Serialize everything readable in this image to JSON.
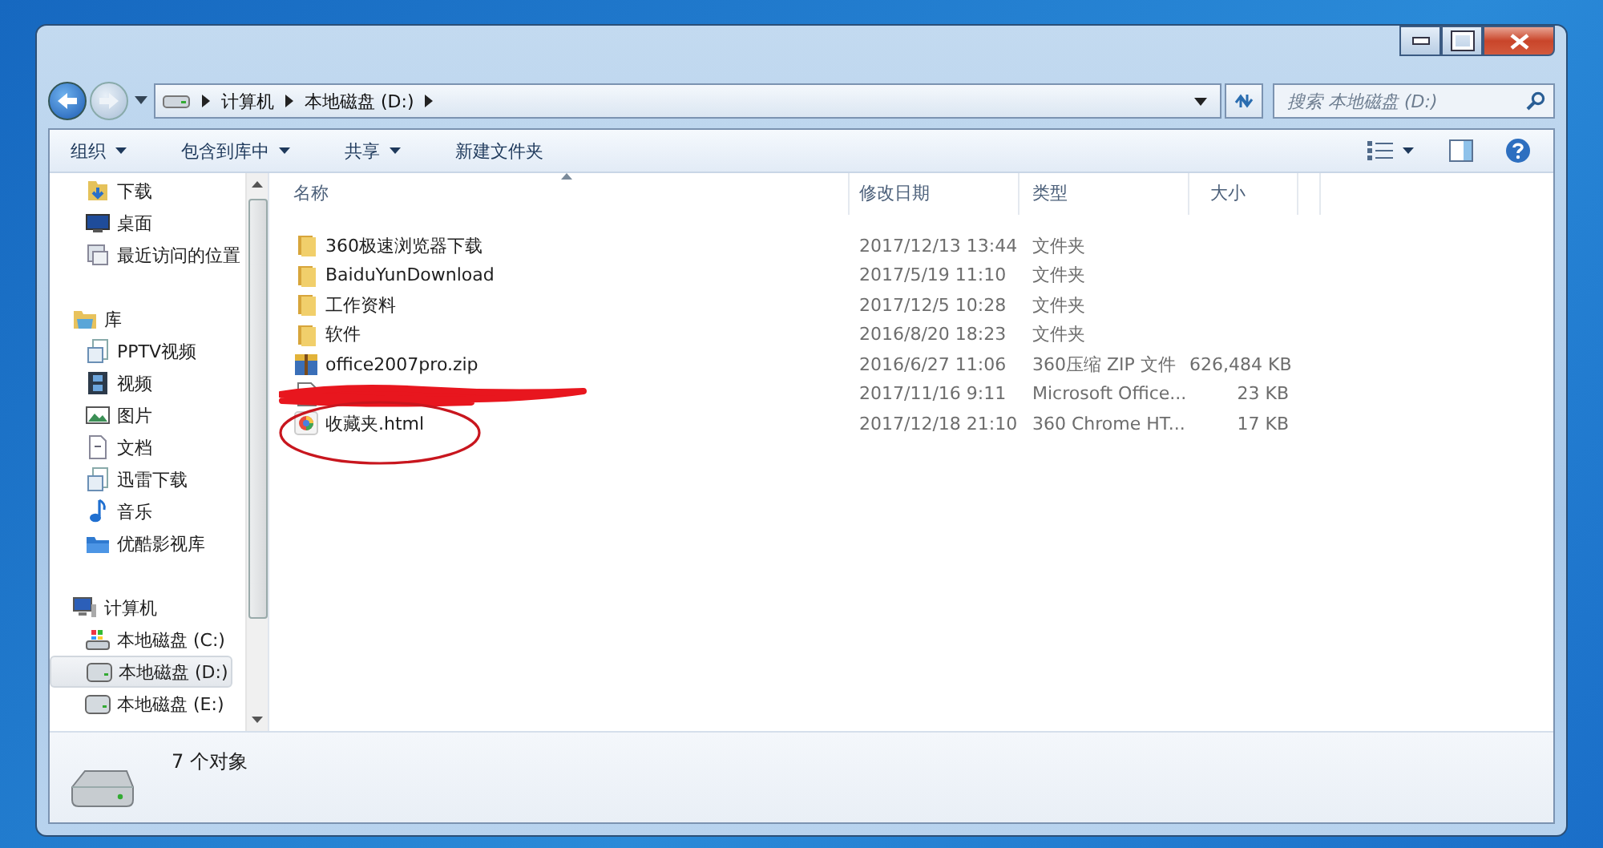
{
  "address": {
    "crumbs": [
      "计算机",
      "本地磁盘 (D:)"
    ]
  },
  "search": {
    "placeholder": "搜索 本地磁盘 (D:)"
  },
  "toolbar": [
    {
      "label": "组织",
      "dropdown": true
    },
    {
      "label": "包含到库中",
      "dropdown": true
    },
    {
      "label": "共享",
      "dropdown": true
    },
    {
      "label": "新建文件夹",
      "dropdown": false
    }
  ],
  "sidebar": {
    "groups": [
      {
        "items": [
          {
            "label": "下载",
            "kind": "download",
            "selected": false
          },
          {
            "label": "桌面",
            "kind": "desktop",
            "selected": false
          },
          {
            "label": "最近访问的位置",
            "kind": "recent",
            "selected": false
          }
        ]
      },
      {
        "header": {
          "label": "库",
          "kind": "library",
          "selected": false
        },
        "items": [
          {
            "label": "PPTV视频",
            "kind": "libitem",
            "selected": false
          },
          {
            "label": "视频",
            "kind": "video",
            "selected": false
          },
          {
            "label": "图片",
            "kind": "picture",
            "selected": false
          },
          {
            "label": "文档",
            "kind": "doc",
            "selected": false
          },
          {
            "label": "迅雷下载",
            "kind": "libitem",
            "selected": false
          },
          {
            "label": "音乐",
            "kind": "music",
            "selected": false
          },
          {
            "label": "优酷影视库",
            "kind": "bluefolder",
            "selected": false
          }
        ]
      },
      {
        "header": {
          "label": "计算机",
          "kind": "computer",
          "selected": false
        },
        "items": [
          {
            "label": "本地磁盘 (C:)",
            "kind": "sysdrive",
            "selected": false
          },
          {
            "label": "本地磁盘 (D:)",
            "kind": "drive",
            "selected": true
          },
          {
            "label": "本地磁盘 (E:)",
            "kind": "drive",
            "selected": false
          }
        ]
      }
    ]
  },
  "file_list": {
    "columns": [
      "名称",
      "修改日期",
      "类型",
      "大小"
    ],
    "rows": [
      {
        "kind": "folder",
        "name": "360极速浏览器下载",
        "date": "2017/12/13 13:44",
        "type": "文件夹",
        "redacted": false,
        "circled": false
      },
      {
        "kind": "folder",
        "name": "BaiduYunDownload",
        "date": "2017/5/19 11:10",
        "type": "文件夹",
        "redacted": false,
        "circled": false
      },
      {
        "kind": "folder",
        "name": "工作资料",
        "date": "2017/12/5 10:28",
        "type": "文件夹",
        "redacted": false,
        "circled": false
      },
      {
        "kind": "folder",
        "name": "软件",
        "date": "2016/8/20 18:23",
        "type": "文件夹",
        "redacted": false,
        "circled": false
      },
      {
        "kind": "zip",
        "name": "office2007pro.zip",
        "date": "2016/6/27 11:06",
        "type": "360压缩 ZIP 文件",
        "size": "626,484 KB",
        "redacted": false,
        "circled": false
      },
      {
        "kind": "doc",
        "date": "2017/11/16 9:11",
        "type": "Microsoft Office...",
        "size": "23 KB",
        "redacted": true,
        "circled": false
      },
      {
        "kind": "html",
        "name": "收藏夹.html",
        "date": "2017/12/18 21:10",
        "type": "360 Chrome HT...",
        "size": "17 KB",
        "redacted": false,
        "circled": true
      }
    ]
  },
  "status_bar": {
    "count": "7 个对象"
  }
}
